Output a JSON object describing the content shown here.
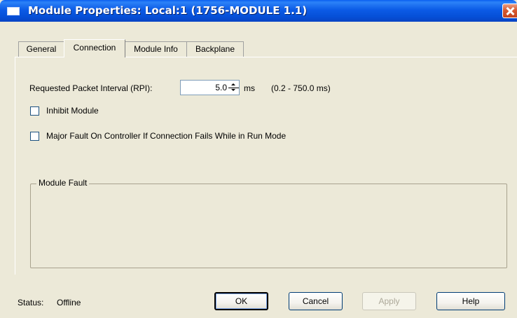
{
  "window": {
    "title": "Module Properties: Local:1 (1756-MODULE 1.1)"
  },
  "tabs": [
    {
      "label": "General",
      "active": false
    },
    {
      "label": "Connection",
      "active": true
    },
    {
      "label": "Module Info",
      "active": false
    },
    {
      "label": "Backplane",
      "active": false
    }
  ],
  "connection": {
    "rpi_label": "Requested Packet Interval (RPI):",
    "rpi_value": "5.0",
    "rpi_unit": "ms",
    "rpi_range": "(0.2 - 750.0 ms)",
    "inhibit_label": "Inhibit Module",
    "inhibit_checked": false,
    "major_fault_label": "Major Fault On Controller If Connection Fails While in Run Mode",
    "major_fault_checked": false,
    "module_fault_label": "Module Fault"
  },
  "status": {
    "label": "Status:",
    "value": "Offline"
  },
  "buttons": {
    "ok": "OK",
    "cancel": "Cancel",
    "apply": "Apply",
    "help": "Help"
  },
  "colors": {
    "titlebar": "#0650D8",
    "dialog_bg": "#ECE9D8",
    "close_button": "#D8592F",
    "disabled_text": "#ACA899"
  }
}
